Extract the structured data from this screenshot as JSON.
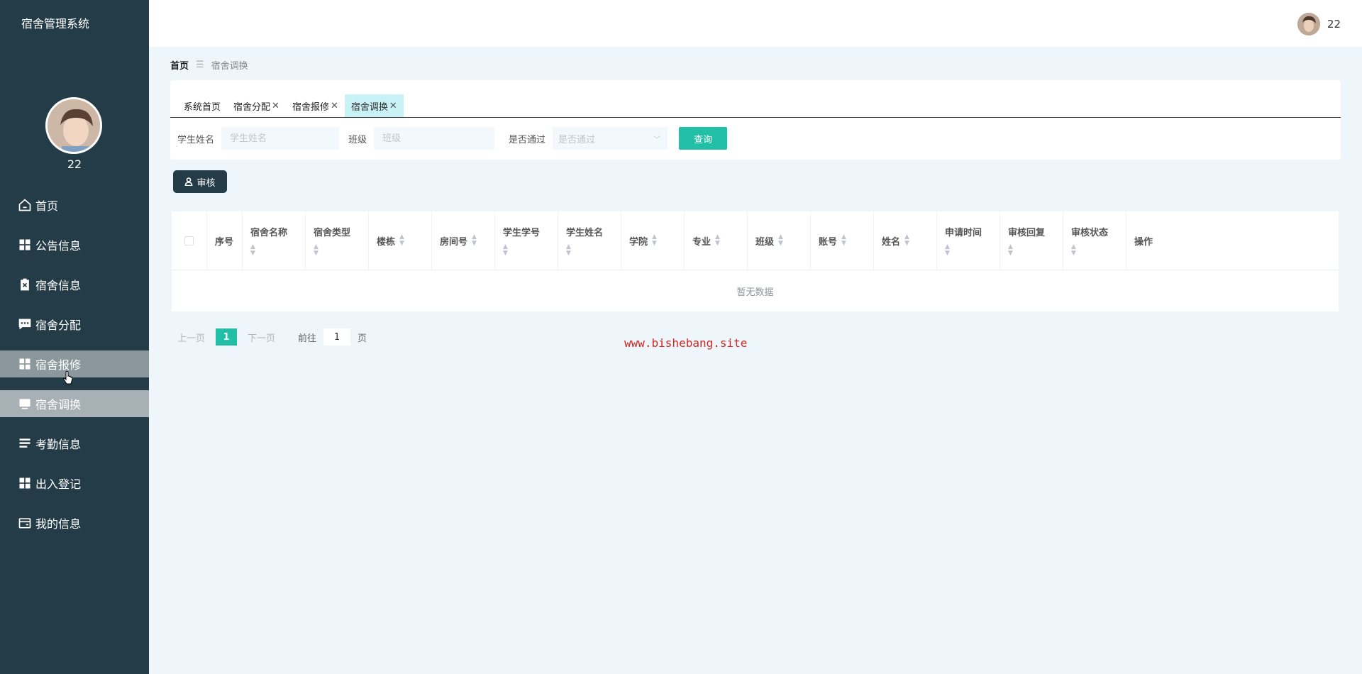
{
  "app": {
    "title": "宿舍管理系统"
  },
  "sidebar": {
    "username": "22",
    "items": [
      {
        "label": "首页",
        "icon": "home-icon"
      },
      {
        "label": "公告信息",
        "icon": "grid-icon"
      },
      {
        "label": "宿舍信息",
        "icon": "clipboard-icon"
      },
      {
        "label": "宿舍分配",
        "icon": "chat-icon"
      },
      {
        "label": "宿舍报修",
        "icon": "grid-icon"
      },
      {
        "label": "宿舍调换",
        "icon": "monitor-icon"
      },
      {
        "label": "考勤信息",
        "icon": "list-icon"
      },
      {
        "label": "出入登记",
        "icon": "grid-icon"
      },
      {
        "label": "我的信息",
        "icon": "wallet-icon"
      }
    ]
  },
  "topbar": {
    "username": "22"
  },
  "breadcrumb": {
    "home": "首页",
    "separator": "☰",
    "current": "宿舍调换"
  },
  "tabs": [
    {
      "label": "系统首页",
      "closable": false
    },
    {
      "label": "宿舍分配",
      "closable": true
    },
    {
      "label": "宿舍报修",
      "closable": true
    },
    {
      "label": "宿舍调换",
      "closable": true,
      "active": true
    }
  ],
  "filters": {
    "student_name_label": "学生姓名",
    "student_name_placeholder": "学生姓名",
    "class_label": "班级",
    "class_placeholder": "班级",
    "passed_label": "是否通过",
    "passed_placeholder": "是否通过",
    "search_button": "查询"
  },
  "actions": {
    "review_button": "审核"
  },
  "table": {
    "columns": [
      "序号",
      "宿舍名称",
      "宿舍类型",
      "楼栋",
      "房间号",
      "学生学号",
      "学生姓名",
      "学院",
      "专业",
      "班级",
      "账号",
      "姓名",
      "申请时间",
      "审核回复",
      "审核状态",
      "操作"
    ],
    "empty_text": "暂无数据"
  },
  "pagination": {
    "prev": "上一页",
    "current_page": "1",
    "next": "下一页",
    "goto_label": "前往",
    "goto_value": "1",
    "goto_unit": "页"
  },
  "watermark": "www.bishebang.site",
  "colors": {
    "sidebar_bg": "#243c47",
    "accent": "#21bfa6",
    "active_tab": "#c8f2f6"
  }
}
